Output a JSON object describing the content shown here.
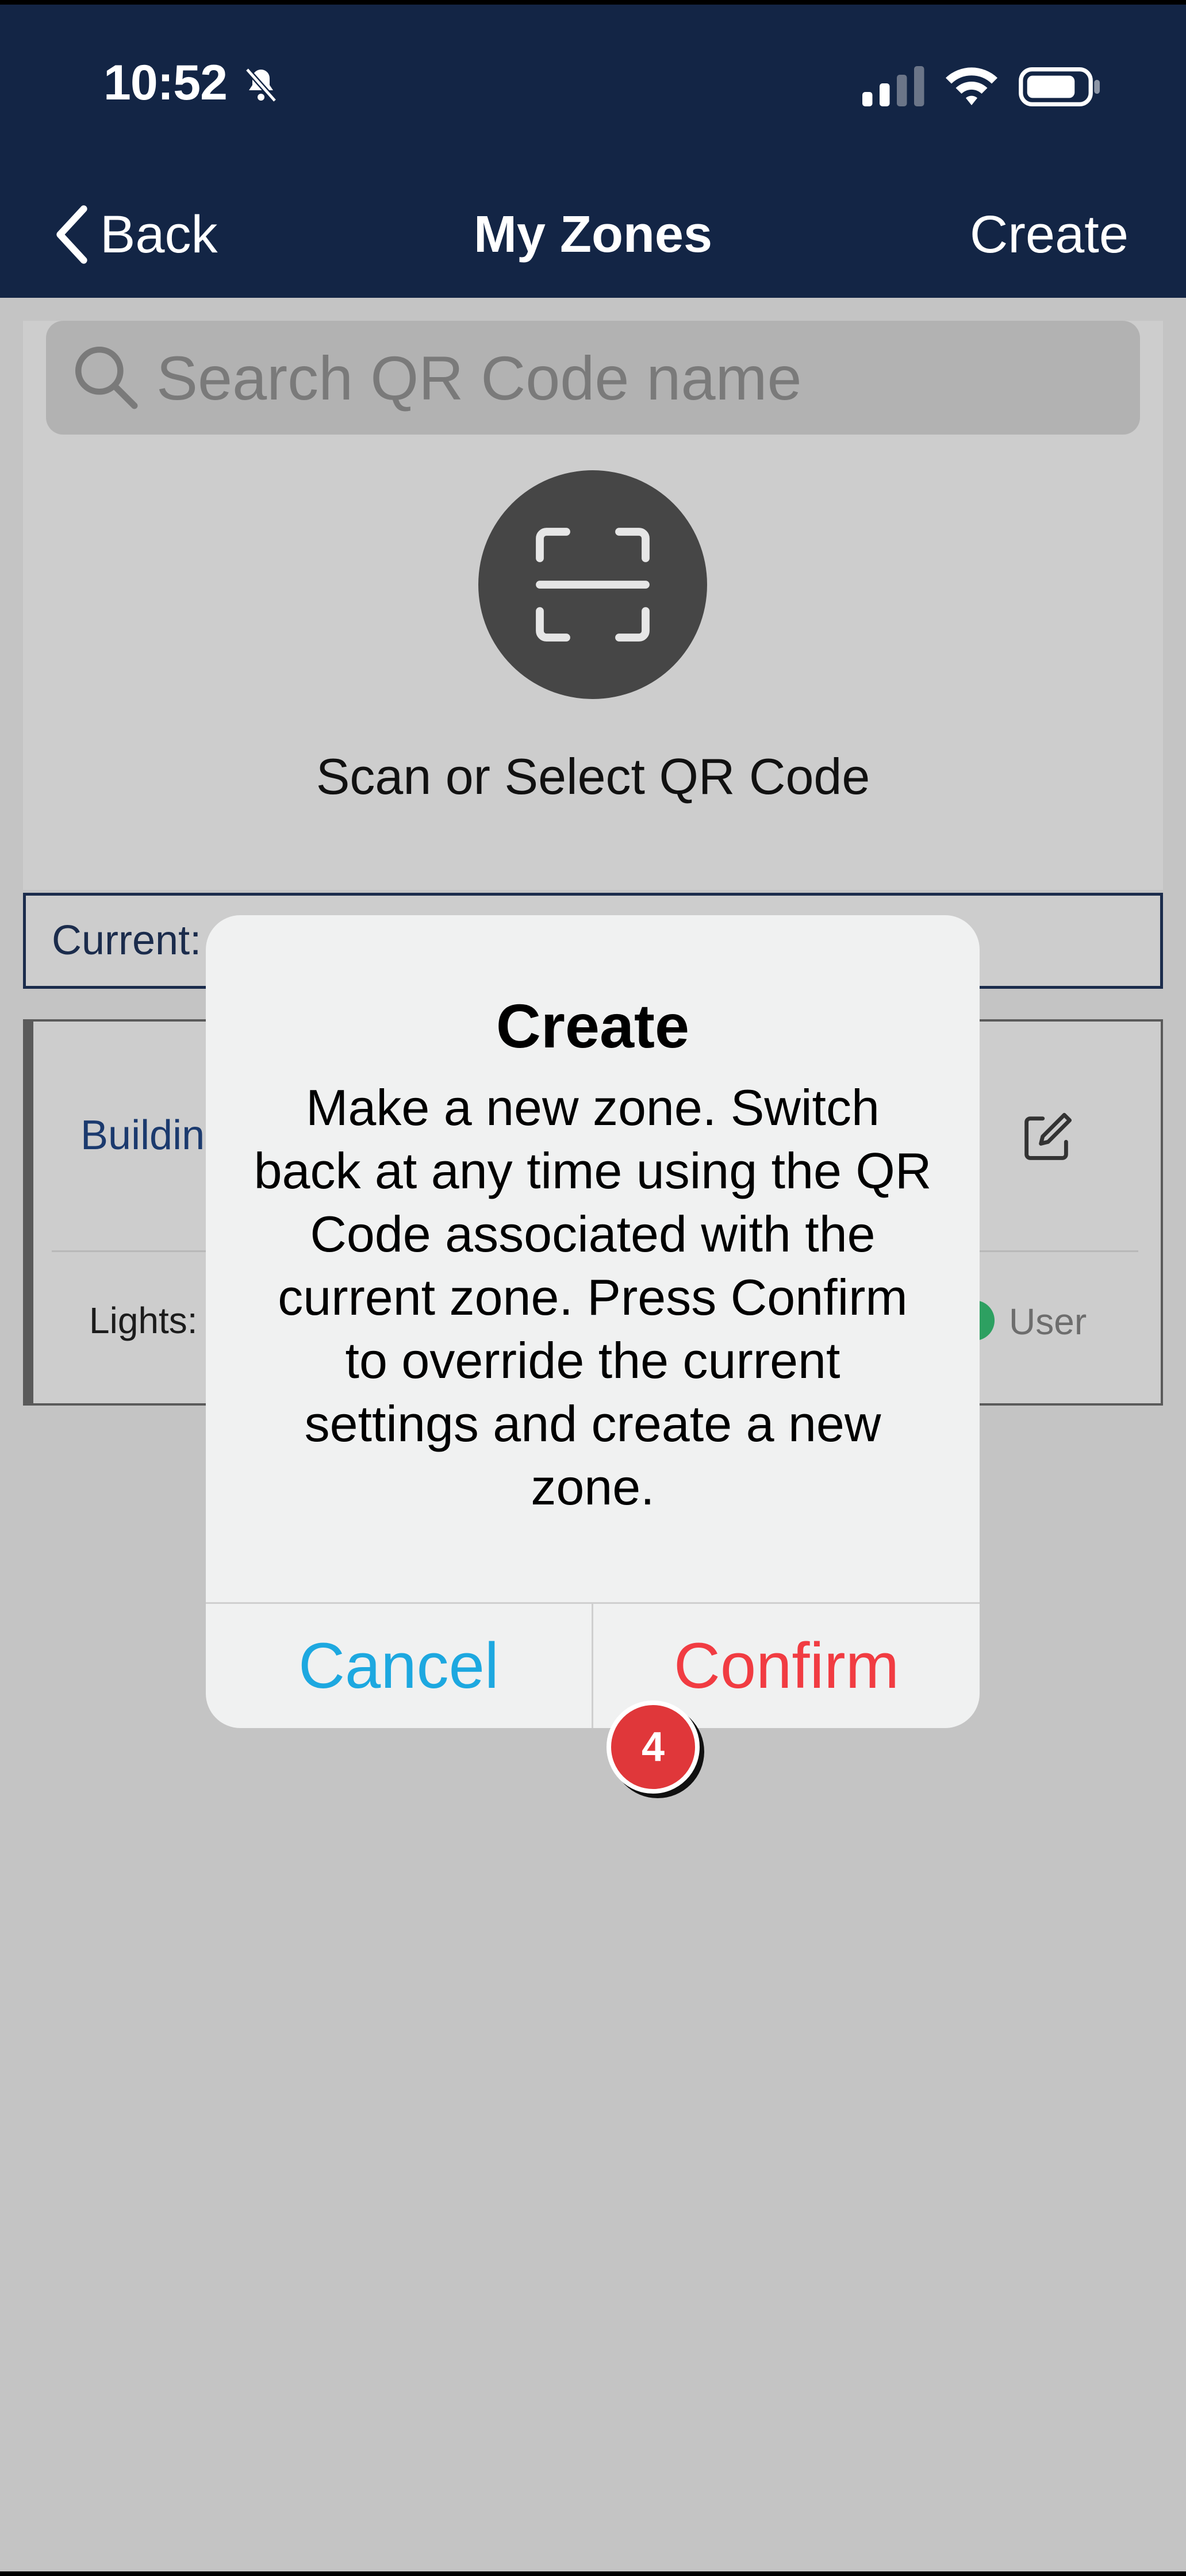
{
  "status_bar": {
    "time": "10:52",
    "icons": [
      "bell-slash-icon",
      "signal-icon",
      "wifi-icon",
      "battery-icon"
    ]
  },
  "nav": {
    "back_label": "Back",
    "title": "My Zones",
    "create_label": "Create"
  },
  "search": {
    "placeholder": "Search QR Code name"
  },
  "scan": {
    "label": "Scan or Select QR Code",
    "icon": "qr-scan-icon"
  },
  "current": {
    "label": "Current:"
  },
  "zone_card": {
    "building_label": "Buildin",
    "lights_label": "Lights:",
    "user_label": "User",
    "edit_icon": "edit-icon"
  },
  "dialog": {
    "title": "Create",
    "message": "Make a new zone. Switch back at any time using the QR Code associated with the current zone. Press Confirm to override the current settings and create a new zone.",
    "cancel_label": "Cancel",
    "confirm_label": "Confirm"
  },
  "step_badge": {
    "number": "4"
  },
  "colors": {
    "header_bg": "#132545",
    "overlay_bg": "#c4c4c4",
    "cancel": "#1da8e0",
    "confirm": "#f13c42",
    "badge": "#e0373a",
    "user_dot": "#2da061"
  }
}
